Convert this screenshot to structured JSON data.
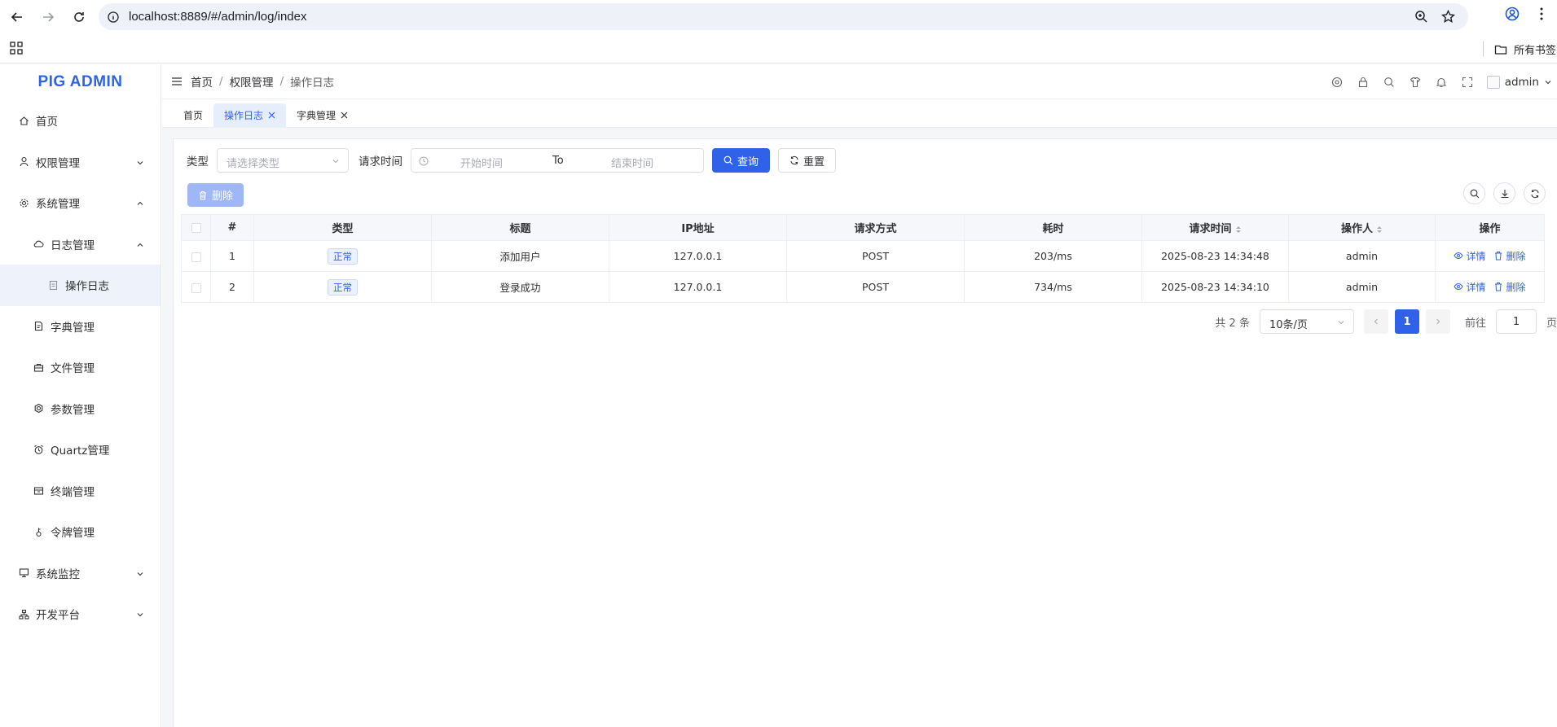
{
  "browser": {
    "url": "localhost:8889/#/admin/log/index",
    "bookmarks_label": "所有书签"
  },
  "app": {
    "logo": "PIG ADMIN",
    "user": "admin"
  },
  "sidebar": {
    "items": [
      {
        "label": "首页",
        "icon": "home-icon"
      },
      {
        "label": "权限管理",
        "icon": "user-icon"
      },
      {
        "label": "系统管理",
        "icon": "gear-icon"
      },
      {
        "label": "日志管理",
        "icon": "cloud-icon"
      },
      {
        "label": "操作日志",
        "icon": "document-icon"
      },
      {
        "label": "字典管理",
        "icon": "dictionary-icon"
      },
      {
        "label": "文件管理",
        "icon": "briefcase-icon"
      },
      {
        "label": "参数管理",
        "icon": "settings-icon"
      },
      {
        "label": "Quartz管理",
        "icon": "alarm-icon"
      },
      {
        "label": "终端管理",
        "icon": "terminal-icon"
      },
      {
        "label": "令牌管理",
        "icon": "token-icon"
      },
      {
        "label": "系统监控",
        "icon": "monitor-icon"
      },
      {
        "label": "开发平台",
        "icon": "org-icon"
      }
    ]
  },
  "breadcrumb": {
    "items": [
      "首页",
      "权限管理",
      "操作日志"
    ]
  },
  "tabs": [
    {
      "label": "首页"
    },
    {
      "label": "操作日志"
    },
    {
      "label": "字典管理"
    }
  ],
  "filters": {
    "type_label": "类型",
    "type_placeholder": "请选择类型",
    "time_label": "请求时间",
    "start_placeholder": "开始时间",
    "range_separator": "To",
    "end_placeholder": "结束时间",
    "search_label": "查询",
    "reset_label": "重置"
  },
  "toolbar": {
    "delete_label": "删除"
  },
  "table": {
    "headers": [
      "#",
      "类型",
      "标题",
      "IP地址",
      "请求方式",
      "耗时",
      "请求时间",
      "操作人",
      "操作"
    ],
    "rows": [
      {
        "index": "1",
        "type": "正常",
        "title": "添加用户",
        "ip": "127.0.0.1",
        "method": "POST",
        "duration": "203/ms",
        "time": "2025-08-23 14:34:48",
        "operator": "admin"
      },
      {
        "index": "2",
        "type": "正常",
        "title": "登录成功",
        "ip": "127.0.0.1",
        "method": "POST",
        "duration": "734/ms",
        "time": "2025-08-23 14:34:10",
        "operator": "admin"
      }
    ],
    "detail_label": "详情",
    "delete_label": "删除"
  },
  "pagination": {
    "total": "共 2 条",
    "page_size": "10条/页",
    "current": "1",
    "goto_label": "前往",
    "goto_value": "1",
    "page_suffix": "页"
  },
  "colors": {
    "primary": "#2f62e8",
    "logo": "#2f62e8"
  }
}
